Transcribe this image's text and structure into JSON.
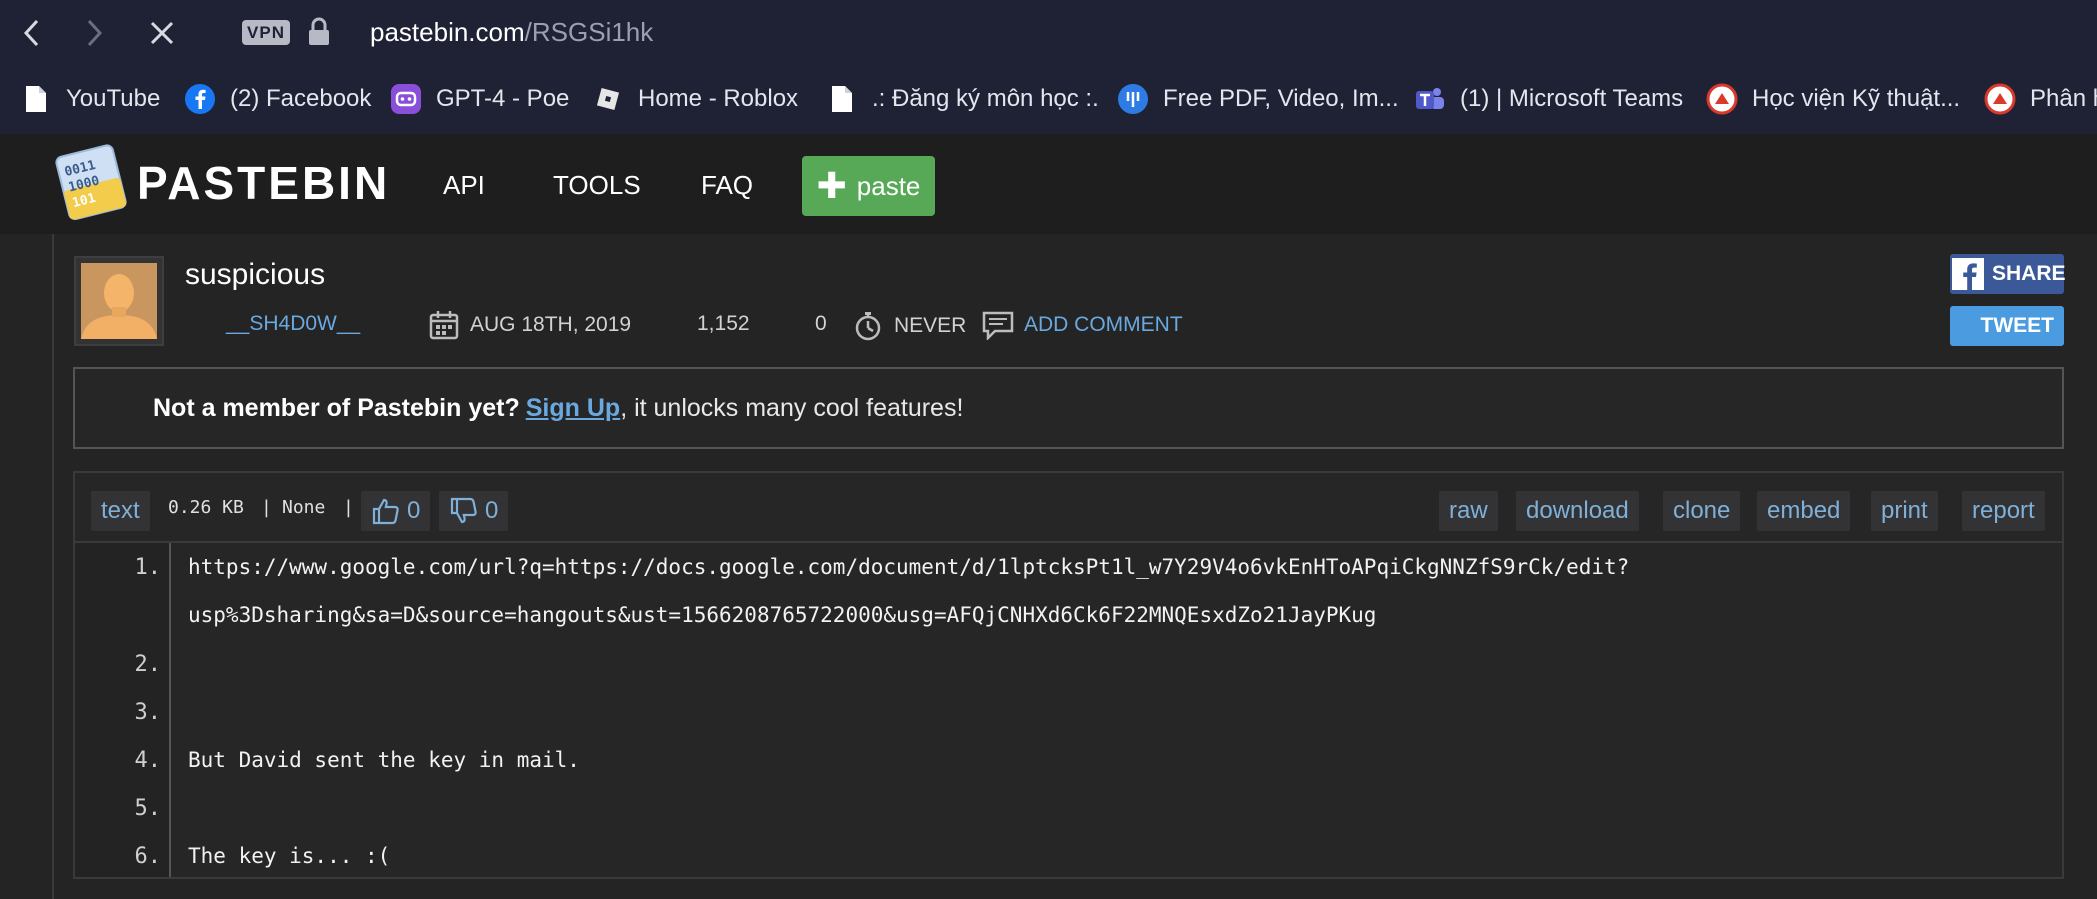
{
  "browser": {
    "vpn_label": "VPN",
    "url_host": "pastebin.com",
    "url_path": "/RSGSi1hk"
  },
  "bookmarks": [
    {
      "label": "YouTube",
      "icon": "file-icon"
    },
    {
      "label": "(2) Facebook",
      "icon": "facebook-icon"
    },
    {
      "label": "GPT-4 - Poe",
      "icon": "poe-icon"
    },
    {
      "label": "Home - Roblox",
      "icon": "roblox-icon"
    },
    {
      "label": ".: Đăng ký môn học :.",
      "icon": "file-icon"
    },
    {
      "label": "Free PDF, Video, Im...",
      "icon": "download-icon"
    },
    {
      "label": "(1) | Microsoft Teams",
      "icon": "teams-icon"
    },
    {
      "label": "Học viện Kỹ thuật...",
      "icon": "academy-icon"
    },
    {
      "label": "Phân h",
      "icon": "academy-icon"
    }
  ],
  "header": {
    "brand": "PASTEBIN",
    "nav": [
      "API",
      "TOOLS",
      "FAQ"
    ],
    "paste_button": "paste"
  },
  "paste": {
    "title": "suspicious",
    "author": "__SH4D0W__",
    "date": "AUG 18TH, 2019",
    "views": "1,152",
    "rating": "0",
    "expiry": "NEVER",
    "add_comment": "ADD COMMENT",
    "share_label": "SHARE",
    "tweet_label": "TWEET"
  },
  "notice": {
    "prefix": "Not a member of Pastebin yet?",
    "signup": "Sign Up",
    "suffix": ", it unlocks many cool features!"
  },
  "code": {
    "syntax": "text",
    "size": "0.26 KB",
    "separator": "|",
    "category": "None",
    "likes": "0",
    "dislikes": "0",
    "actions": [
      "raw",
      "download",
      "clone",
      "embed",
      "print",
      "report"
    ],
    "line_numbers": [
      "1.",
      "2.",
      "3.",
      "4.",
      "5.",
      "6."
    ],
    "lines": [
      "https://www.google.com/url?q=https://docs.google.com/document/d/1lptcksPt1l_w7Y29V4o6vkEnHToAPqiCkgNNZfS9rCk/edit?",
      "usp%3Dsharing&sa=D&source=hangouts&ust=1566208765722000&usg=AFQjCNHXd6Ck6F22MNQEsxdZo21JayPKug",
      "But David sent the key in mail.",
      "The key is... :("
    ]
  }
}
